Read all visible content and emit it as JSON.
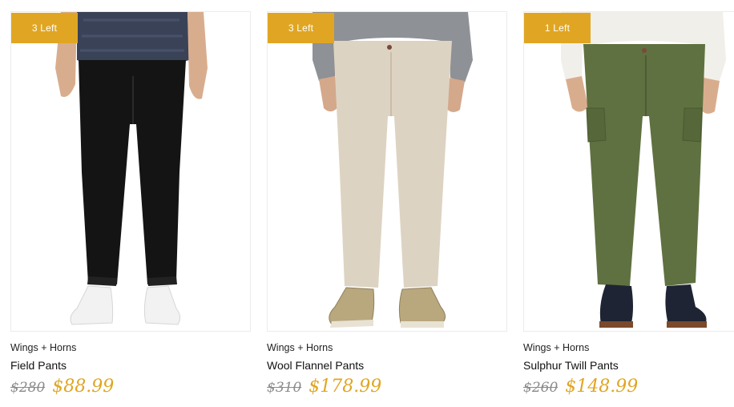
{
  "colors": {
    "badge_bg": "#e0a623",
    "sale_price": "#e0a623",
    "original_price": "#8a8a8a"
  },
  "products": [
    {
      "badge": "3 Left",
      "brand": "Wings + Horns",
      "name": "Field Pants",
      "original_price": "$280",
      "sale_price": "$88.99",
      "image_icon": "model-black-pants-image"
    },
    {
      "badge": "3 Left",
      "brand": "Wings + Horns",
      "name": "Wool Flannel Pants",
      "original_price": "$310",
      "sale_price": "$178.99",
      "image_icon": "model-beige-pants-image"
    },
    {
      "badge": "1 Left",
      "brand": "Wings + Horns",
      "name": "Sulphur Twill Pants",
      "original_price": "$260",
      "sale_price": "$148.99",
      "image_icon": "model-olive-pants-image"
    }
  ]
}
